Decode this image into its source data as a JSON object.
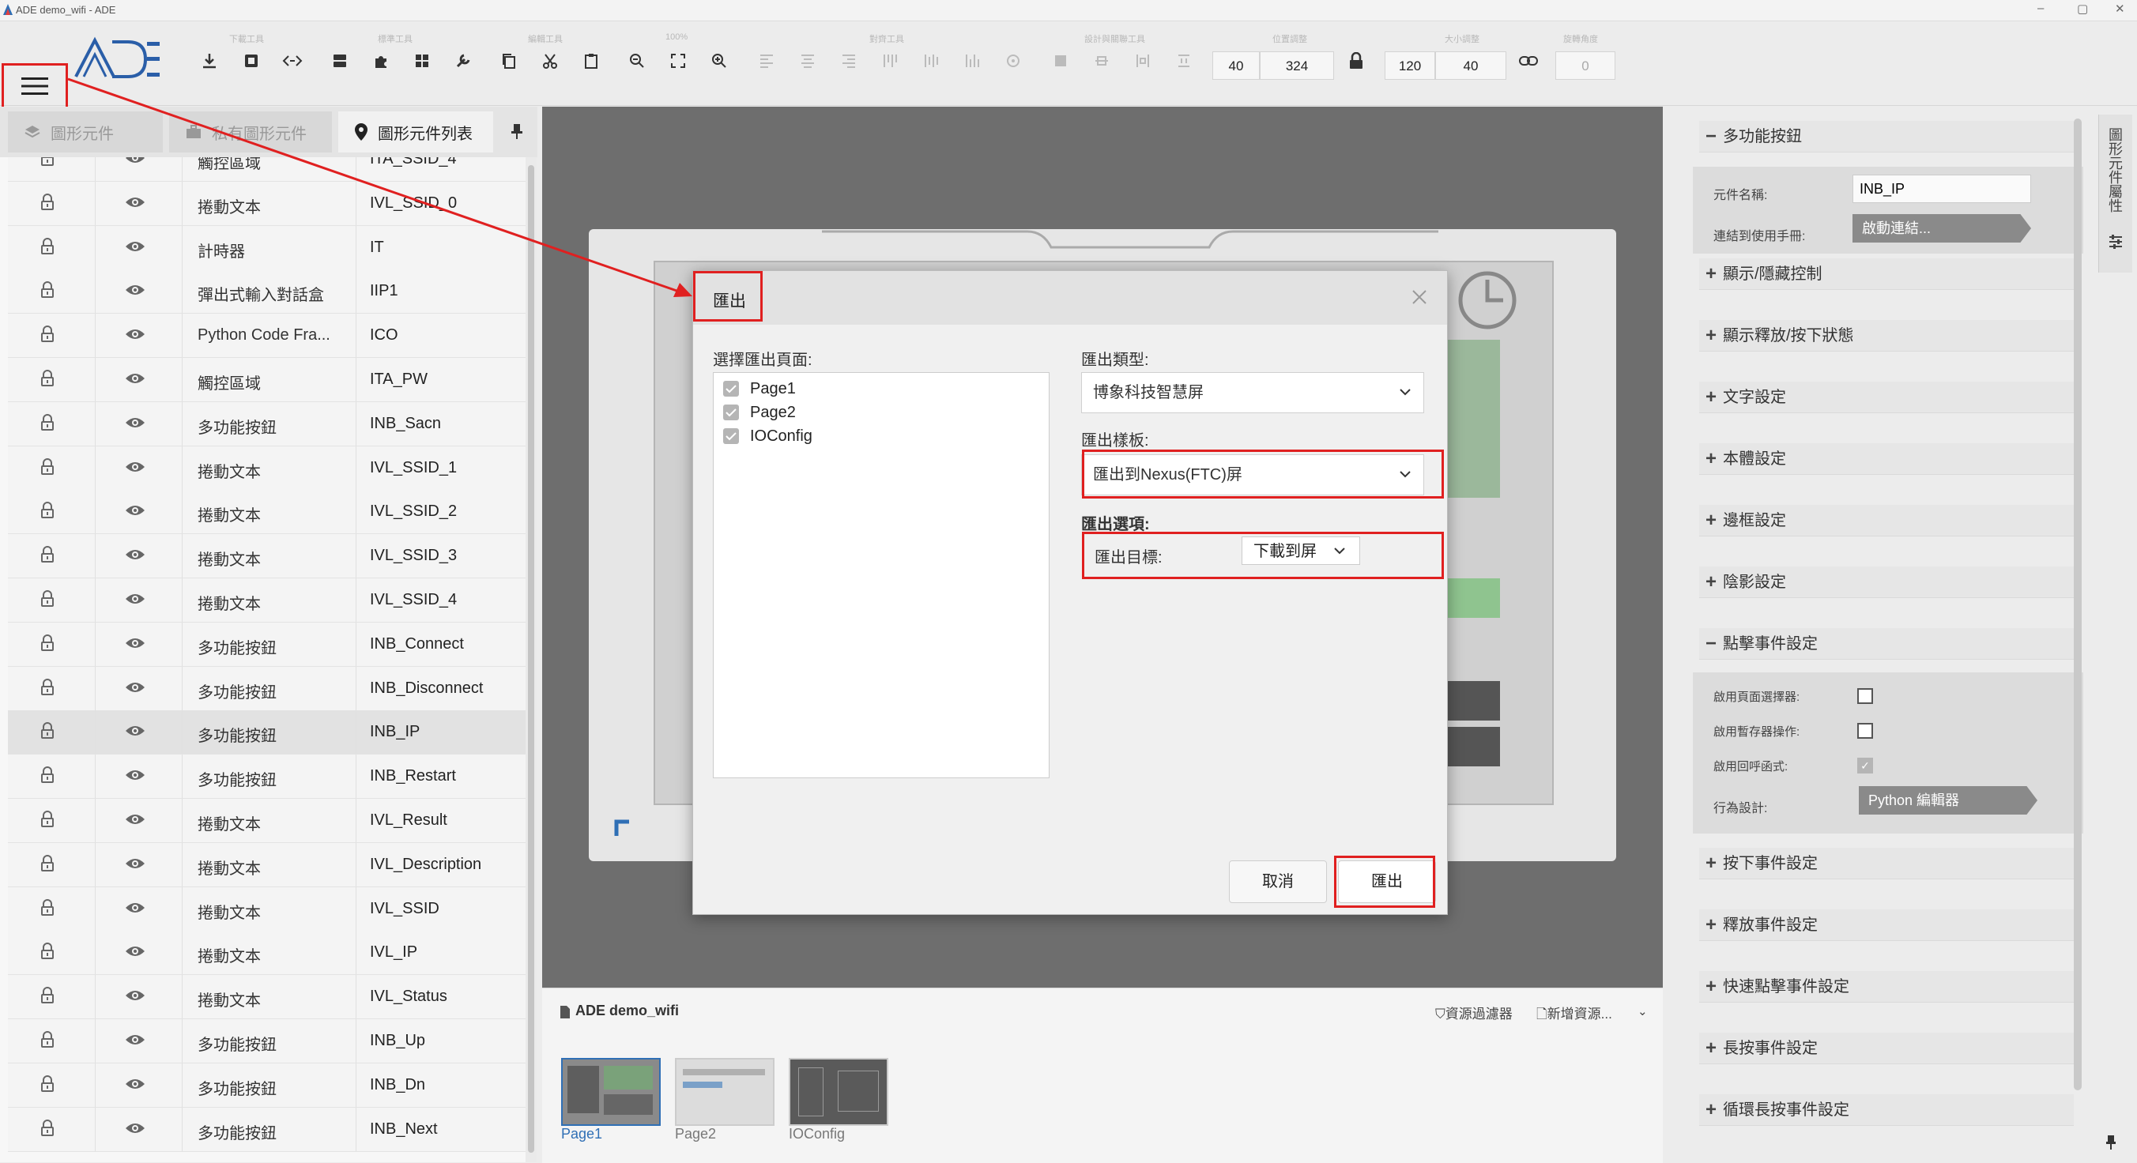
{
  "window": {
    "title": "ADE demo_wifi - ADE",
    "min": "–",
    "max": "▢",
    "close": "✕"
  },
  "toolbar": {
    "groups": [
      "下載工具",
      "標準工具",
      "編輯工具",
      "100%",
      "對齊工具",
      "設計與關聯工具",
      "位置調整",
      "大小調整",
      "旋轉角度"
    ],
    "x": "40",
    "y": "324",
    "width": "120",
    "height": "40",
    "rotation": "0"
  },
  "left_panel": {
    "tabs": [
      "圖形元件",
      "私有圖形元件",
      "圖形元件列表"
    ],
    "rows": [
      {
        "type": "觸控區域",
        "name": "ITA_SSID_4"
      },
      {
        "type": "捲動文本",
        "name": "IVL_SSID_0"
      },
      {
        "type": "計時器",
        "name": "IT"
      },
      {
        "type": "彈出式輸入對話盒",
        "name": "IIP1"
      },
      {
        "type": "Python Code Fra...",
        "name": "ICO"
      },
      {
        "type": "觸控區域",
        "name": "ITA_PW"
      },
      {
        "type": "多功能按鈕",
        "name": "INB_Sacn"
      },
      {
        "type": "捲動文本",
        "name": "IVL_SSID_1"
      },
      {
        "type": "捲動文本",
        "name": "IVL_SSID_2"
      },
      {
        "type": "捲動文本",
        "name": "IVL_SSID_3"
      },
      {
        "type": "捲動文本",
        "name": "IVL_SSID_4"
      },
      {
        "type": "多功能按鈕",
        "name": "INB_Connect"
      },
      {
        "type": "多功能按鈕",
        "name": "INB_Disconnect"
      },
      {
        "type": "多功能按鈕",
        "name": "INB_IP"
      },
      {
        "type": "多功能按鈕",
        "name": "INB_Restart"
      },
      {
        "type": "捲動文本",
        "name": "IVL_Result"
      },
      {
        "type": "捲動文本",
        "name": "IVL_Description"
      },
      {
        "type": "捲動文本",
        "name": "IVL_SSID"
      },
      {
        "type": "捲動文本",
        "name": "IVL_IP"
      },
      {
        "type": "捲動文本",
        "name": "IVL_Status"
      },
      {
        "type": "多功能按鈕",
        "name": "INB_Up"
      },
      {
        "type": "多功能按鈕",
        "name": "INB_Dn"
      },
      {
        "type": "多功能按鈕",
        "name": "INB_Next"
      }
    ]
  },
  "pages_bar": {
    "project": "ADE demo_wifi",
    "filter": "資源過濾器",
    "new_resource": "新增資源...",
    "pages": [
      "Page1",
      "Page2",
      "IOConfig"
    ]
  },
  "right_panel": {
    "vertical_tab": "圖形元件屬性",
    "sections": {
      "multi_button": "多功能按鈕",
      "show_hide": "顯示/隱藏控制",
      "release_press": "顯示釋放/按下狀態",
      "text": "文字設定",
      "body": "本體設定",
      "border": "邊框設定",
      "shadow": "陰影設定",
      "click_event": "點擊事件設定",
      "press_event": "按下事件設定",
      "release_event": "釋放事件設定",
      "quick_click": "快速點擊事件設定",
      "long_press": "長按事件設定",
      "loop_long_press": "循環長按事件設定"
    },
    "name_label": "元件名稱:",
    "name_value": "INB_IP",
    "link_label": "連結到使用手冊:",
    "link_button": "啟動連結...",
    "page_selector_label": "啟用頁面選擇器:",
    "temp_op_label": "啟用暫存器操作:",
    "callback_label": "啟用回呼函式:",
    "behavior_label": "行為設計:",
    "python_editor": "Python 編輯器"
  },
  "dialog": {
    "title": "匯出",
    "select_pages_label": "選擇匯出頁面:",
    "pages": [
      "Page1",
      "Page2",
      "IOConfig"
    ],
    "export_type_label": "匯出類型:",
    "export_type_value": "博象科技智慧屏",
    "export_template_label": "匯出樣板:",
    "export_template_value": "匯出到Nexus(FTC)屏",
    "export_options_label": "匯出選項:",
    "export_target_label": "匯出目標:",
    "export_target_value": "下載到屏",
    "cancel": "取消",
    "export": "匯出"
  },
  "colors": {
    "highlight": "#e02020",
    "accent": "#2f6fb5"
  }
}
